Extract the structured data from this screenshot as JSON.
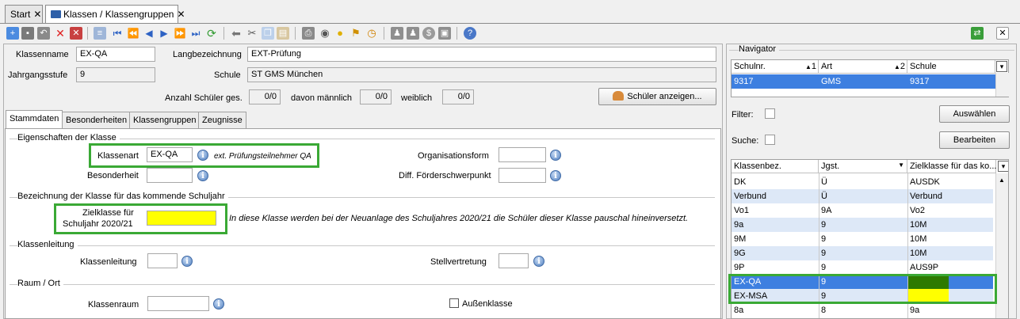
{
  "tabs": [
    {
      "label": "Start"
    },
    {
      "label": "Klassen / Klassengruppen"
    }
  ],
  "toolbar": {
    "icons": [
      "new-icon",
      "save-icon",
      "undo-icon",
      "delete-icon",
      "delete-all-icon",
      "list-icon",
      "first-icon",
      "prev-page-icon",
      "prev-icon",
      "next-icon",
      "next-page-icon",
      "last-icon",
      "refresh-icon",
      "back-icon",
      "cut-icon",
      "copy-icon",
      "paste-icon",
      "print-icon",
      "preview-icon",
      "bulb-icon",
      "broom-icon",
      "clock-icon",
      "users-icon",
      "users2-icon",
      "coin-icon",
      "export-icon",
      "help-icon"
    ]
  },
  "form": {
    "klassenname_label": "Klassenname",
    "klassenname_value": "EX-QA",
    "langbezeichnung_label": "Langbezeichnung",
    "langbezeichnung_value": "EXT-Prüfung",
    "jahrgangsstufe_label": "Jahrgangsstufe",
    "jahrgangsstufe_value": "9",
    "schule_label": "Schule",
    "schule_value": "ST GMS München",
    "anzahl_label": "Anzahl Schüler ges.",
    "anzahl_value": "0/0",
    "maennlich_label": "davon männlich",
    "maennlich_value": "0/0",
    "weiblich_label": "weiblich",
    "weiblich_value": "0/0",
    "schueler_button": "Schüler anzeigen..."
  },
  "subtabs": [
    "Stammdaten",
    "Besonderheiten",
    "Klassengruppen",
    "Zeugnisse"
  ],
  "stammdaten": {
    "sec_eigenschaften": "Eigenschaften der Klasse",
    "klassenart_label": "Klassenart",
    "klassenart_value": "EX-QA",
    "klassenart_note": "ext. Prüfungsteilnehmer QA",
    "organisationsform_label": "Organisationsform",
    "besonderheit_label": "Besonderheit",
    "diff_label": "Diff. Förderschwerpunkt",
    "sec_bezeichnung": "Bezeichnung der Klasse für das kommende Schuljahr",
    "zielklasse_label_1": "Zielklasse für",
    "zielklasse_label_2": "Schuljahr 2020/21",
    "zielklasse_note": "In diese Klasse werden bei der Neuanlage des Schuljahres 2020/21 die Schüler dieser Klasse pauschal hineinversetzt.",
    "sec_klassenleitung": "Klassenleitung",
    "klassenleitung_label": "Klassenleitung",
    "stellvertretung_label": "Stellvertretung",
    "sec_raum": "Raum / Ort",
    "klassenraum_label": "Klassenraum",
    "aussenklasse_label": "Außenklasse"
  },
  "navigator": {
    "title": "Navigator",
    "headers": [
      "Schulnr.",
      "Art",
      "Schule"
    ],
    "sort_marks": [
      "1",
      "2"
    ],
    "rows": [
      [
        "9317",
        "GMS",
        "9317"
      ]
    ],
    "filter_label": "Filter:",
    "suche_label": "Suche:",
    "auswaehlen_button": "Auswählen",
    "bearbeiten_button": "Bearbeiten"
  },
  "classlist": {
    "headers": [
      "Klassenbez.",
      "Jgst.",
      "Zielklasse für das ko..."
    ],
    "rows": [
      [
        "DK",
        "Ü",
        "AUSDK"
      ],
      [
        "Verbund",
        "Ü",
        "Verbund"
      ],
      [
        "Vo1",
        "9A",
        "Vo2"
      ],
      [
        "9a",
        "9",
        "10M"
      ],
      [
        "9M",
        "9",
        "10M"
      ],
      [
        "9G",
        "9",
        "10M"
      ],
      [
        "9P",
        "9",
        "AUS9P"
      ],
      [
        "EX-QA",
        "9",
        ""
      ],
      [
        "EX-MSA",
        "9",
        ""
      ],
      [
        "8a",
        "8",
        "9a"
      ]
    ]
  },
  "colors": {
    "accent_green": "#3aa935",
    "selection_blue": "#3d7fe0",
    "highlight_yellow": "#ffff00",
    "dark_green_cell": "#2d7a00"
  }
}
